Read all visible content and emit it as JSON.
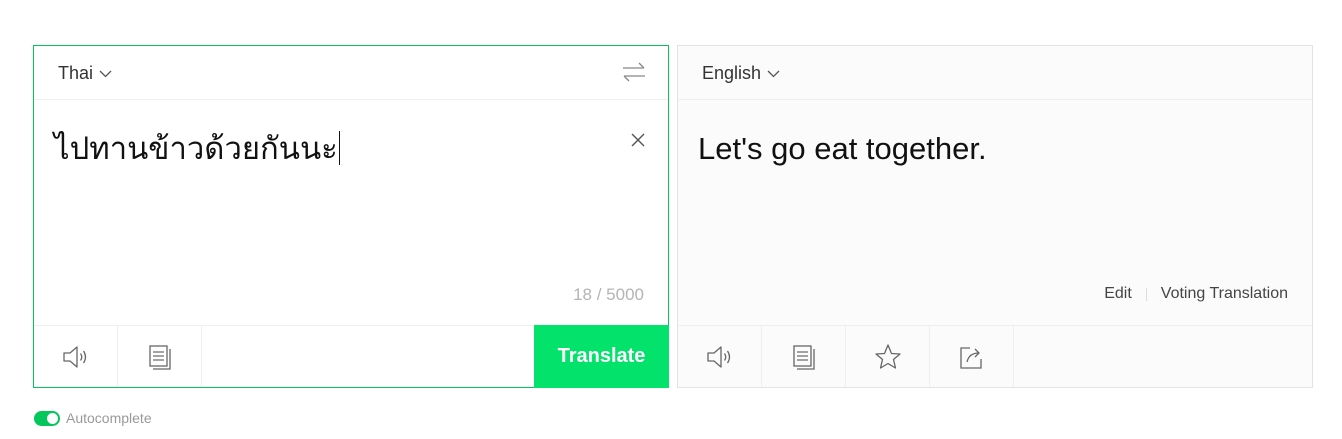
{
  "source": {
    "language": "Thai",
    "text": "ไปทานข้าวด้วยกันนะ",
    "counter": "18 / 5000",
    "translate_label": "Translate",
    "tools": [
      "speaker-icon",
      "copy-icon"
    ]
  },
  "target": {
    "language": "English",
    "text": "Let's go eat together.",
    "edit_label": "Edit",
    "voting_label": "Voting Translation",
    "tools": [
      "speaker-icon",
      "copy-icon",
      "star-icon",
      "share-icon"
    ]
  },
  "autocomplete": {
    "label": "Autocomplete",
    "enabled": true
  },
  "colors": {
    "accent": "#03c75a",
    "translate_button": "#03e26b"
  }
}
